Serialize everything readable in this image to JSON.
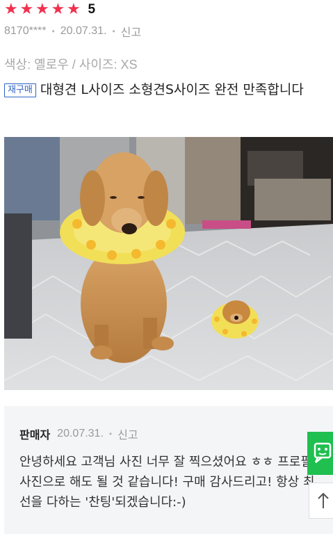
{
  "review": {
    "stars": [
      "★",
      "★",
      "★",
      "★",
      "★"
    ],
    "rating": "5",
    "user_id": "8170****",
    "date": "20.07.31.",
    "report_label": "신고",
    "options": "색상: 옐로우 / 사이즈: XS",
    "repurchase_badge": "재구매",
    "text": "대형견 L사이즈 소형견S사이즈 완전 만족합니다"
  },
  "seller": {
    "name": "판매자",
    "date": "20.07.31.",
    "report_label": "신고",
    "reply": "안녕하세요 고객님 사진 너무 잘 찍으셨어요 ㅎㅎ 프로필 사진으로 해도 될 것 같습니다! 구매 감사드리고! 항상 최선을 다하는 '찬팅'되겠습니다:-)"
  },
  "colors": {
    "star": "#f1314f",
    "badge": "#2b63c4",
    "chat_green": "#1fbf50",
    "seller_bg": "#f4f5f7"
  },
  "icons": {
    "chat": "chat-bubble-icon",
    "scroll_top": "arrow-up-icon"
  }
}
